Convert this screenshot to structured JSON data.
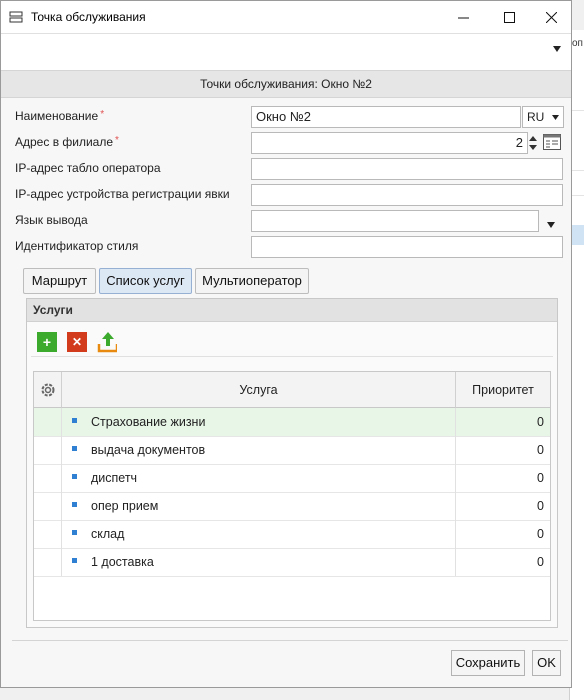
{
  "window": {
    "title": "Точка обслуживания"
  },
  "toolbar": {
    "dropdown_icon": "triangle-down-icon"
  },
  "header": {
    "text": "Точки обслуживания:   Окно №2"
  },
  "form": {
    "name_label": "Наименование",
    "name_value": "Окно №2",
    "lang_value": "RU",
    "address_label": "Адрес в филиале",
    "address_value": "2",
    "ip_board_label": "IP-адрес табло оператора",
    "ip_reg_label": "IP-адрес устройства регистрации явки",
    "lang_output_label": "Язык вывода",
    "style_label": "Идентификатор стиля",
    "required_mark": "*"
  },
  "tabs": [
    {
      "label": "Маршрут"
    },
    {
      "label": "Список услуг"
    },
    {
      "label": "Мультиоператор"
    }
  ],
  "services": {
    "panel_title": "Услуги",
    "columns": {
      "service": "Услуга",
      "priority": "Приоритет"
    },
    "rows": [
      {
        "name": "Страхование жизни",
        "priority": "0"
      },
      {
        "name": "выдача документов",
        "priority": "0"
      },
      {
        "name": "диспетч",
        "priority": "0"
      },
      {
        "name": "опер прием",
        "priority": "0"
      },
      {
        "name": "склад",
        "priority": "0"
      },
      {
        "name": "1 доставка",
        "priority": "0"
      }
    ]
  },
  "footer": {
    "save_label": "Сохранить",
    "ok_label": "OK"
  },
  "background": {
    "fragment_text": "оп"
  },
  "colors": {
    "selected_row": "#e8f6e8",
    "add_button": "#3caa2d",
    "delete_button": "#d23b1c",
    "export_icon": "#e88a10"
  }
}
